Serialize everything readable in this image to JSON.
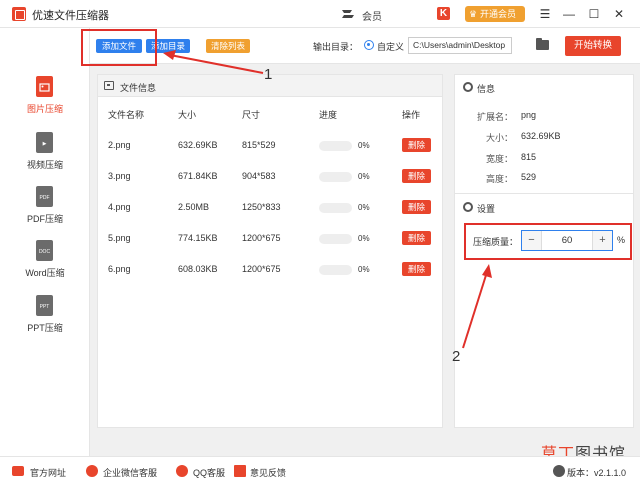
{
  "app": {
    "title": "优速文件压缩器",
    "member_label": "会员",
    "vip_button": "开通会员"
  },
  "window_controls": [
    "☰",
    "—",
    "☐",
    "✕"
  ],
  "sidebar": {
    "items": [
      {
        "label": "图片压缩",
        "icon": "image-file-icon",
        "badge": "",
        "active": true
      },
      {
        "label": "视频压缩",
        "icon": "video-file-icon",
        "badge": "▶",
        "active": false
      },
      {
        "label": "PDF压缩",
        "icon": "pdf-file-icon",
        "badge": "PDF",
        "active": false
      },
      {
        "label": "Word压缩",
        "icon": "doc-file-icon",
        "badge": "DOC",
        "active": false
      },
      {
        "label": "PPT压缩",
        "icon": "ppt-file-icon",
        "badge": "PPT",
        "active": false
      }
    ]
  },
  "toolbar": {
    "add_file": "添加文件",
    "add_dir": "添加目录",
    "clear_list": "清除列表",
    "output_label": "输出目录：",
    "radio_label": "自定义",
    "output_path": "C:\\Users\\admin\\Desktop",
    "start_button": "开始转换"
  },
  "file_panel": {
    "title": "文件信息",
    "columns": [
      "文件名称",
      "大小",
      "尺寸",
      "进度",
      "操作"
    ],
    "rows": [
      {
        "name": "2.png",
        "size": "632.69KB",
        "dims": "815*529",
        "progress": "0%",
        "action": "删除"
      },
      {
        "name": "3.png",
        "size": "671.84KB",
        "dims": "904*583",
        "progress": "0%",
        "action": "删除"
      },
      {
        "name": "4.png",
        "size": "2.50MB",
        "dims": "1250*833",
        "progress": "0%",
        "action": "删除"
      },
      {
        "name": "5.png",
        "size": "774.15KB",
        "dims": "1200*675",
        "progress": "0%",
        "action": "删除"
      },
      {
        "name": "6.png",
        "size": "608.03KB",
        "dims": "1200*675",
        "progress": "0%",
        "action": "删除"
      }
    ]
  },
  "info_panel": {
    "title": "信息",
    "fields": [
      {
        "key": "扩展名：",
        "value": "png"
      },
      {
        "key": "大小：",
        "value": "632.69KB"
      },
      {
        "key": "宽度：",
        "value": "815"
      },
      {
        "key": "高度：",
        "value": "529"
      }
    ],
    "settings_title": "设置",
    "quality_label": "压缩质量：",
    "quality_value": "60",
    "minus": "−",
    "plus": "+",
    "unit": "%"
  },
  "annotations": {
    "one": "1",
    "two": "2"
  },
  "footer": {
    "official_site": "官方网址",
    "wechat_service": "企业微信客服",
    "qq_service": "QQ客服",
    "feedback": "意见反馈",
    "version": "版本：v2.1.1.0"
  },
  "watermark": {
    "part1": "草丁",
    "part2": "图书馆"
  },
  "colors": {
    "accent_red": "#e8452c",
    "accent_blue": "#2f80ed",
    "accent_orange": "#f0a030"
  }
}
